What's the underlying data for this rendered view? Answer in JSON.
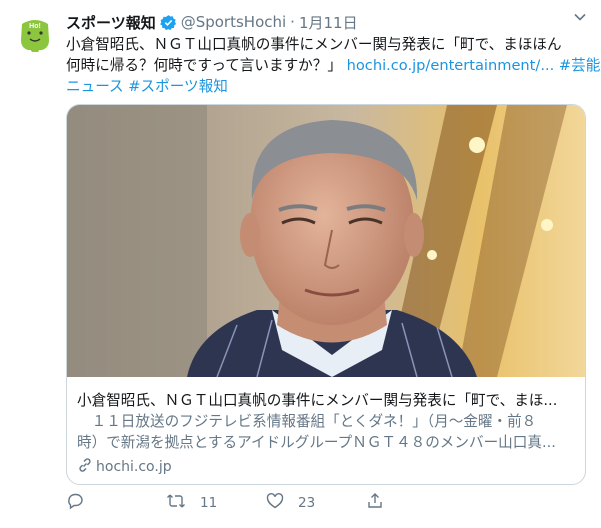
{
  "tweet": {
    "account_name": "スポーツ報知",
    "handle": "@SportsHochi",
    "separator": "·",
    "date": "1月11日",
    "text_line1": "小倉智昭氏、ＮＧＴ山口真帆の事件にメンバー関与発表に「町で、まほほん",
    "text_line2_pre": "何時に帰る？何時ですって言いますか？」",
    "text_line2_link": "hochi.co.jp/entertainment/...",
    "text_line2_tag": "#芸能",
    "text_line3": "ニュース #スポーツ報知",
    "avatar_text": "Ho!"
  },
  "card": {
    "title": "小倉智昭氏、ＮＧＴ山口真帆の事件にメンバー関与発表に「町で、まほ...",
    "desc_line1": "　１１日放送のフジテレビ系情報番組「とくダネ！」（月～金曜・前８",
    "desc_line2": "時）で新潟を拠点とするアイドルグループＮＧＴ４８のメンバー山口真...",
    "domain": "hochi.co.jp"
  },
  "actions": {
    "reply_count": "",
    "retweet_count": "11",
    "like_count": "23"
  },
  "colors": {
    "link": "#1b95e0",
    "secondary": "#657786",
    "verified": "#1da1f2",
    "avatar_green": "#8cc63f",
    "border": "#ccd6dd"
  },
  "icons": [
    "verified-badge-icon",
    "chevron-down-icon",
    "link-icon",
    "reply-icon",
    "retweet-icon",
    "like-icon",
    "share-icon"
  ]
}
